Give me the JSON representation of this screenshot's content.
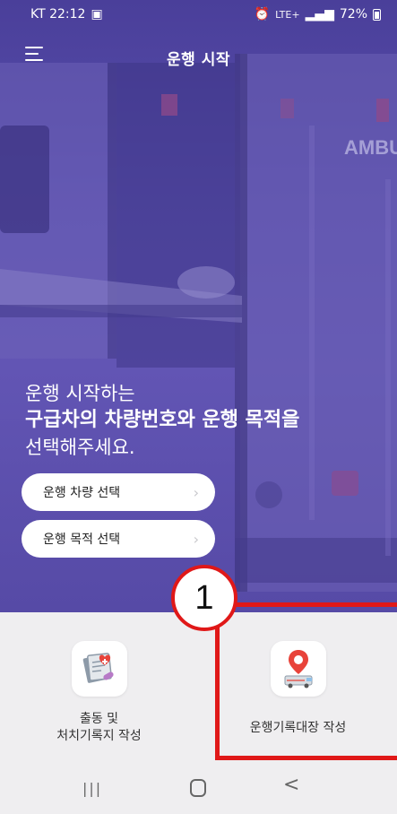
{
  "status_bar": {
    "carrier_time": "KT 22:12",
    "signal_text": "LTE+",
    "battery": "72%"
  },
  "app_bar": {
    "title": "운행 시작",
    "menu_icon": "hamburger-menu-icon"
  },
  "hero": {
    "line1": "운행 시작하는",
    "line2": "구급차의 차량번호와 운행 목적을",
    "line3": "선택해주세요.",
    "vehicle_text": "AMBU",
    "buttons": [
      {
        "label": "운행 차량 선택",
        "icon": "chevron-right-icon"
      },
      {
        "label": "운행 목적 선택",
        "icon": "chevron-right-icon"
      }
    ]
  },
  "cards": [
    {
      "line1": "출동 및",
      "line2": "처치기록지 작성",
      "icon": "medical-record-icon"
    },
    {
      "label": "운행기록대장 작성",
      "icon": "ambulance-location-icon"
    }
  ],
  "annotation": {
    "number": "1",
    "color": "#e01818"
  },
  "nav_bar": {
    "recent": "|||",
    "back": "<"
  },
  "colors": {
    "hero_overlay": "#5a4fae",
    "panel_bg": "#efeef0",
    "annotation": "#e01818"
  }
}
